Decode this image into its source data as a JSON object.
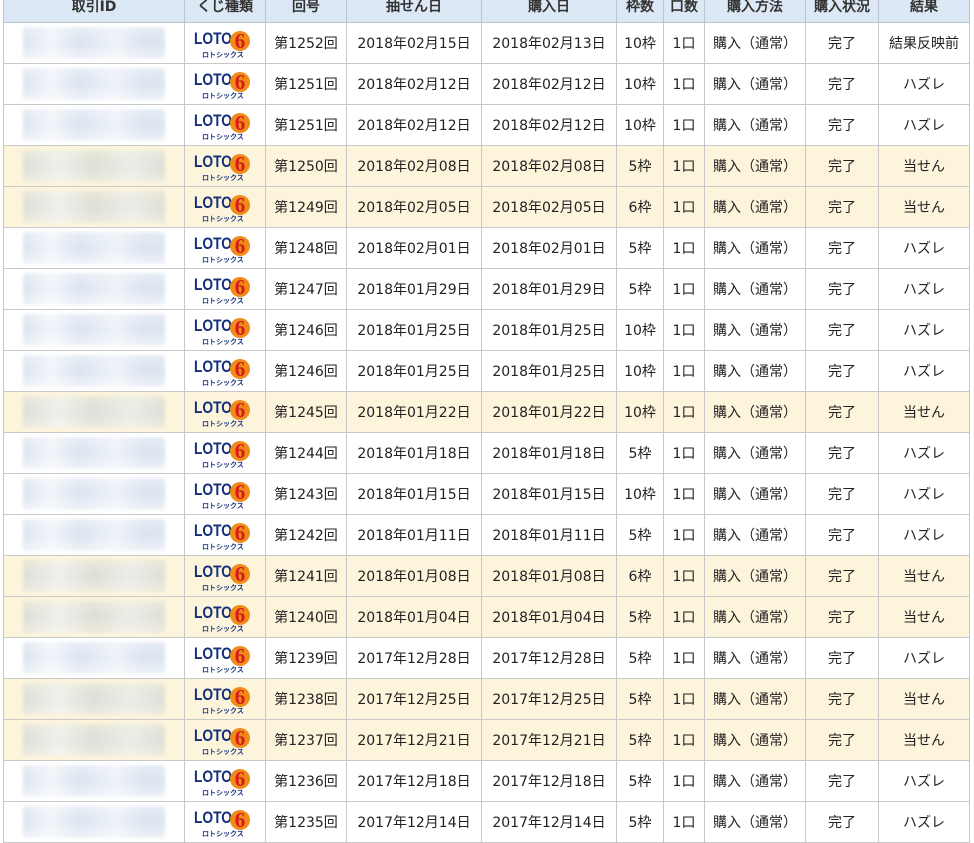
{
  "headers": {
    "id": "取引ID",
    "type": "くじ種類",
    "round": "回号",
    "draw_date": "抽せん日",
    "purchase_date": "購入日",
    "slots": "枠数",
    "units": "口数",
    "method": "購入方法",
    "status": "購入状況",
    "result": "結果"
  },
  "logo": {
    "main": "LOTO",
    "digit": "6",
    "sub": "ロトシックス",
    "icon": "loto6-logo-icon"
  },
  "colors": {
    "header_bg": "#dce8f6",
    "win_row_bg": "#fcf5dc",
    "logo_navy": "#15307a",
    "logo_orange": "#f08a18",
    "logo_red": "#d41a1a"
  },
  "rows": [
    {
      "round": "第1252回",
      "draw": "2018年02月15日",
      "buy": "2018年02月13日",
      "slots": "10枠",
      "units": "1口",
      "method": "購入（通常）",
      "status": "完了",
      "result": "結果反映前",
      "win": false
    },
    {
      "round": "第1251回",
      "draw": "2018年02月12日",
      "buy": "2018年02月12日",
      "slots": "10枠",
      "units": "1口",
      "method": "購入（通常）",
      "status": "完了",
      "result": "ハズレ",
      "win": false
    },
    {
      "round": "第1251回",
      "draw": "2018年02月12日",
      "buy": "2018年02月12日",
      "slots": "10枠",
      "units": "1口",
      "method": "購入（通常）",
      "status": "完了",
      "result": "ハズレ",
      "win": false
    },
    {
      "round": "第1250回",
      "draw": "2018年02月08日",
      "buy": "2018年02月08日",
      "slots": "5枠",
      "units": "1口",
      "method": "購入（通常）",
      "status": "完了",
      "result": "当せん",
      "win": true
    },
    {
      "round": "第1249回",
      "draw": "2018年02月05日",
      "buy": "2018年02月05日",
      "slots": "6枠",
      "units": "1口",
      "method": "購入（通常）",
      "status": "完了",
      "result": "当せん",
      "win": true
    },
    {
      "round": "第1248回",
      "draw": "2018年02月01日",
      "buy": "2018年02月01日",
      "slots": "5枠",
      "units": "1口",
      "method": "購入（通常）",
      "status": "完了",
      "result": "ハズレ",
      "win": false
    },
    {
      "round": "第1247回",
      "draw": "2018年01月29日",
      "buy": "2018年01月29日",
      "slots": "5枠",
      "units": "1口",
      "method": "購入（通常）",
      "status": "完了",
      "result": "ハズレ",
      "win": false
    },
    {
      "round": "第1246回",
      "draw": "2018年01月25日",
      "buy": "2018年01月25日",
      "slots": "10枠",
      "units": "1口",
      "method": "購入（通常）",
      "status": "完了",
      "result": "ハズレ",
      "win": false
    },
    {
      "round": "第1246回",
      "draw": "2018年01月25日",
      "buy": "2018年01月25日",
      "slots": "10枠",
      "units": "1口",
      "method": "購入（通常）",
      "status": "完了",
      "result": "ハズレ",
      "win": false
    },
    {
      "round": "第1245回",
      "draw": "2018年01月22日",
      "buy": "2018年01月22日",
      "slots": "10枠",
      "units": "1口",
      "method": "購入（通常）",
      "status": "完了",
      "result": "当せん",
      "win": true
    },
    {
      "round": "第1244回",
      "draw": "2018年01月18日",
      "buy": "2018年01月18日",
      "slots": "5枠",
      "units": "1口",
      "method": "購入（通常）",
      "status": "完了",
      "result": "ハズレ",
      "win": false
    },
    {
      "round": "第1243回",
      "draw": "2018年01月15日",
      "buy": "2018年01月15日",
      "slots": "10枠",
      "units": "1口",
      "method": "購入（通常）",
      "status": "完了",
      "result": "ハズレ",
      "win": false
    },
    {
      "round": "第1242回",
      "draw": "2018年01月11日",
      "buy": "2018年01月11日",
      "slots": "5枠",
      "units": "1口",
      "method": "購入（通常）",
      "status": "完了",
      "result": "ハズレ",
      "win": false
    },
    {
      "round": "第1241回",
      "draw": "2018年01月08日",
      "buy": "2018年01月08日",
      "slots": "6枠",
      "units": "1口",
      "method": "購入（通常）",
      "status": "完了",
      "result": "当せん",
      "win": true
    },
    {
      "round": "第1240回",
      "draw": "2018年01月04日",
      "buy": "2018年01月04日",
      "slots": "5枠",
      "units": "1口",
      "method": "購入（通常）",
      "status": "完了",
      "result": "当せん",
      "win": true
    },
    {
      "round": "第1239回",
      "draw": "2017年12月28日",
      "buy": "2017年12月28日",
      "slots": "5枠",
      "units": "1口",
      "method": "購入（通常）",
      "status": "完了",
      "result": "ハズレ",
      "win": false
    },
    {
      "round": "第1238回",
      "draw": "2017年12月25日",
      "buy": "2017年12月25日",
      "slots": "5枠",
      "units": "1口",
      "method": "購入（通常）",
      "status": "完了",
      "result": "当せん",
      "win": true
    },
    {
      "round": "第1237回",
      "draw": "2017年12月21日",
      "buy": "2017年12月21日",
      "slots": "5枠",
      "units": "1口",
      "method": "購入（通常）",
      "status": "完了",
      "result": "当せん",
      "win": true
    },
    {
      "round": "第1236回",
      "draw": "2017年12月18日",
      "buy": "2017年12月18日",
      "slots": "5枠",
      "units": "1口",
      "method": "購入（通常）",
      "status": "完了",
      "result": "ハズレ",
      "win": false
    },
    {
      "round": "第1235回",
      "draw": "2017年12月14日",
      "buy": "2017年12月14日",
      "slots": "5枠",
      "units": "1口",
      "method": "購入（通常）",
      "status": "完了",
      "result": "ハズレ",
      "win": false
    }
  ]
}
